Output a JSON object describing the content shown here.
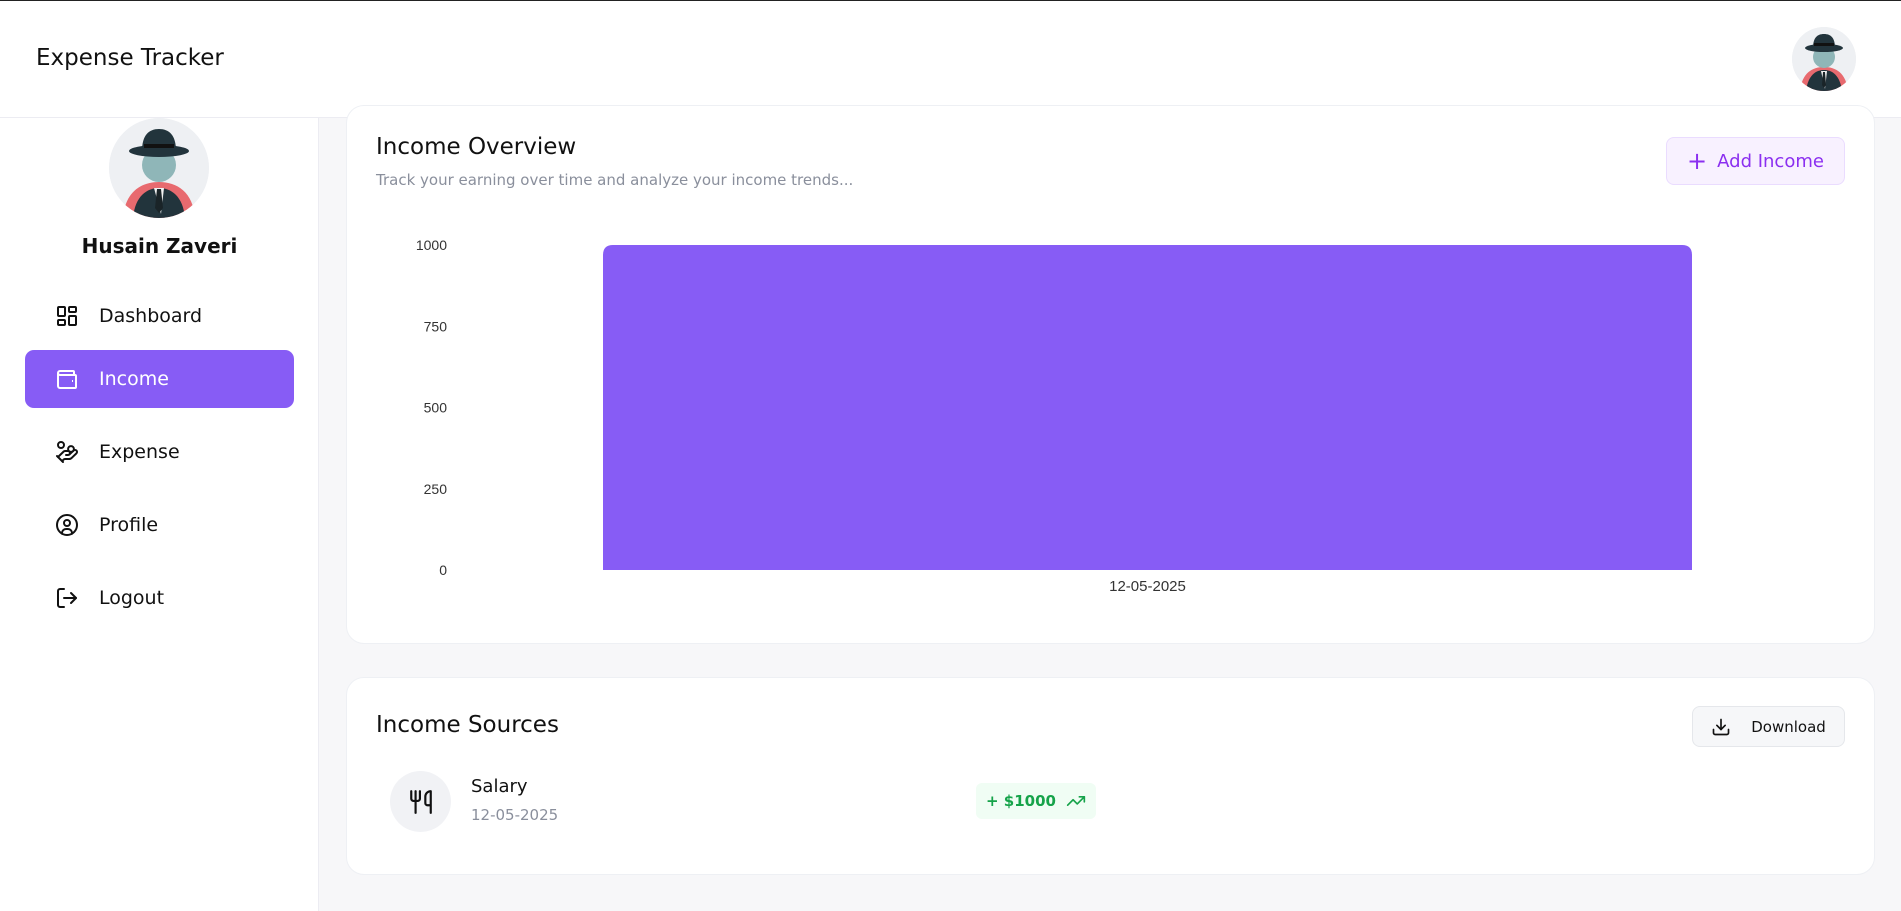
{
  "app": {
    "title": "Expense Tracker"
  },
  "user": {
    "name": "Husain Zaveri"
  },
  "sidebar": {
    "items": [
      {
        "label": "Dashboard",
        "icon": "dashboard-icon",
        "active": false
      },
      {
        "label": "Income",
        "icon": "wallet-icon",
        "active": true
      },
      {
        "label": "Expense",
        "icon": "hand-coins-icon",
        "active": false
      },
      {
        "label": "Profile",
        "icon": "user-circle-icon",
        "active": false
      },
      {
        "label": "Logout",
        "icon": "logout-icon",
        "active": false
      }
    ]
  },
  "overview": {
    "title": "Income Overview",
    "subtitle": "Track your earning over time and analyze your income trends...",
    "add_button_label": "Add Income"
  },
  "chart_data": {
    "type": "bar",
    "categories": [
      "12-05-2025"
    ],
    "values": [
      1000
    ],
    "ylim": [
      0,
      1000
    ],
    "yticks": [
      0,
      250,
      500,
      750,
      1000
    ],
    "color": "#875cf5",
    "grid": false
  },
  "sources": {
    "title": "Income Sources",
    "download_label": "Download",
    "items": [
      {
        "name": "Salary",
        "date": "12-05-2025",
        "amount": "+ $1000",
        "icon": "utensils-icon",
        "trend": "trending-up-icon"
      }
    ]
  },
  "colors": {
    "accent": "#875cf5",
    "accent_text": "#8b2ff0",
    "positive": "#16a34a"
  }
}
